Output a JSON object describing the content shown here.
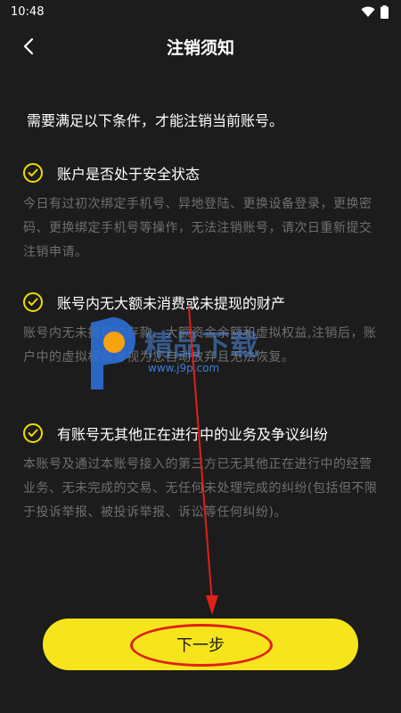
{
  "status_bar": {
    "time": "10:48"
  },
  "nav": {
    "title": "注销须知"
  },
  "intro": "需要满足以下条件，才能注销当前账号。",
  "sections": [
    {
      "title": "账户是否处于安全状态",
      "desc": "今日有过初次绑定手机号、异地登陆、更换设备登录，更换密码、更换绑定手机号等操作，无法注销账号，请次日重新提交注销申请。"
    },
    {
      "title": "账号内无大额未消费或未提现的财产",
      "desc": "账号内无未提现的存款、大额资金余额和虚拟权益,注销后，账户中的虚拟权益等视为您自动放弃且无法恢复。"
    },
    {
      "title": "有账号无其他正在进行中的业务及争议纠纷",
      "desc": "本账号及通过本账号接入的第三方已无其他正在进行中的经营业务、无未完成的交易、无任何未处理完成的纠纷(包括但不限于投诉举报、被投诉举报、诉讼等任何纠纷)。"
    }
  ],
  "watermark": {
    "text": "精品下载",
    "url": "www.j9p.com"
  },
  "next_button": {
    "label": "下一步"
  },
  "colors": {
    "accent": "#f6e51c",
    "annotation": "#e0201a"
  }
}
